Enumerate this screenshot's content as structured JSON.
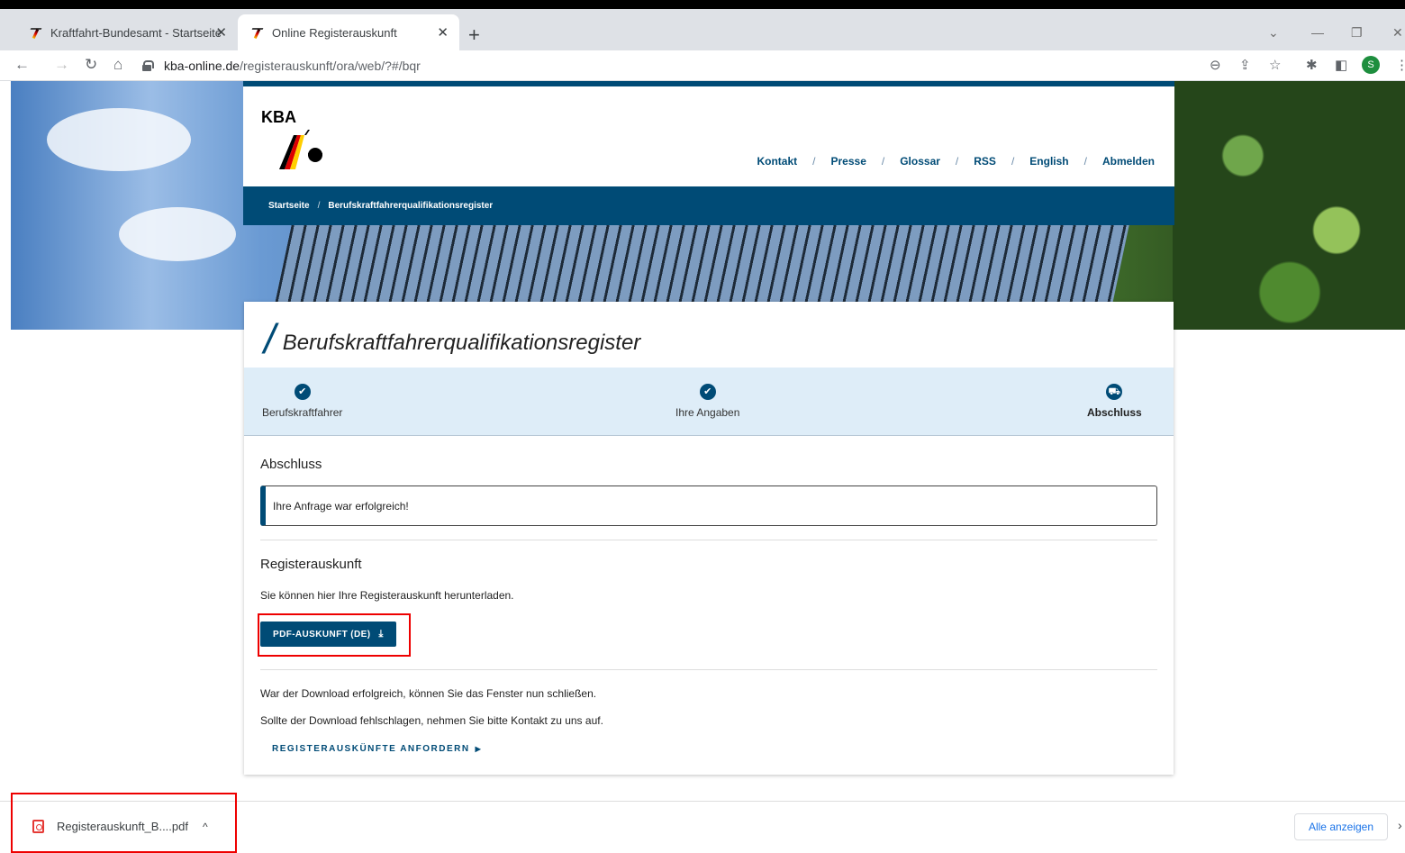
{
  "browser": {
    "tabs": [
      {
        "title": "Kraftfahrt-Bundesamt - Startseite",
        "close": "✕"
      },
      {
        "title": "Online Registerauskunft",
        "close": "✕"
      }
    ],
    "new_tab": "+",
    "url_domain": "kba-online.de",
    "url_path": "/registerauskunft/ora/web/?#/bqr",
    "profile_initial": "S"
  },
  "site": {
    "logo_text": "KBA",
    "nav": [
      "Kontakt",
      "Presse",
      "Glossar",
      "RSS",
      "English",
      "Abmelden"
    ],
    "nav_sep": "/",
    "breadcrumb": [
      "Startseite",
      "Berufskraftfahrerqualifikationsregister"
    ]
  },
  "page": {
    "title_slash": "/",
    "title": "Berufskraftfahrerqualifikationsregister",
    "steps": [
      {
        "label": "Berufskraftfahrer",
        "icon": "check-icon"
      },
      {
        "label": "Ihre Angaben",
        "icon": "check-icon"
      },
      {
        "label": "Abschluss",
        "icon": "truck-icon"
      }
    ],
    "section1_title": "Abschluss",
    "alert": "Ihre Anfrage war erfolgreich!",
    "section2_title": "Registerauskunft",
    "section2_text": "Sie können hier Ihre Registerauskunft herunterladen.",
    "pdf_button": "PDF-AUSKUNFT (DE)",
    "text3": "War der Download erfolgreich, können Sie das Fenster nun schließen.",
    "text4": "Sollte der Download fehlschlagen, nehmen Sie bitte Kontakt zu uns auf.",
    "request_link": "REGISTERAUSKÜNFTE ANFORDERN"
  },
  "download_bar": {
    "file": "Registerauskunft_B....pdf",
    "show_all": "Alle anzeigen"
  },
  "colors": {
    "brand": "#004b76",
    "highlight": "#e00000",
    "stepper_bg": "#deedf8"
  }
}
